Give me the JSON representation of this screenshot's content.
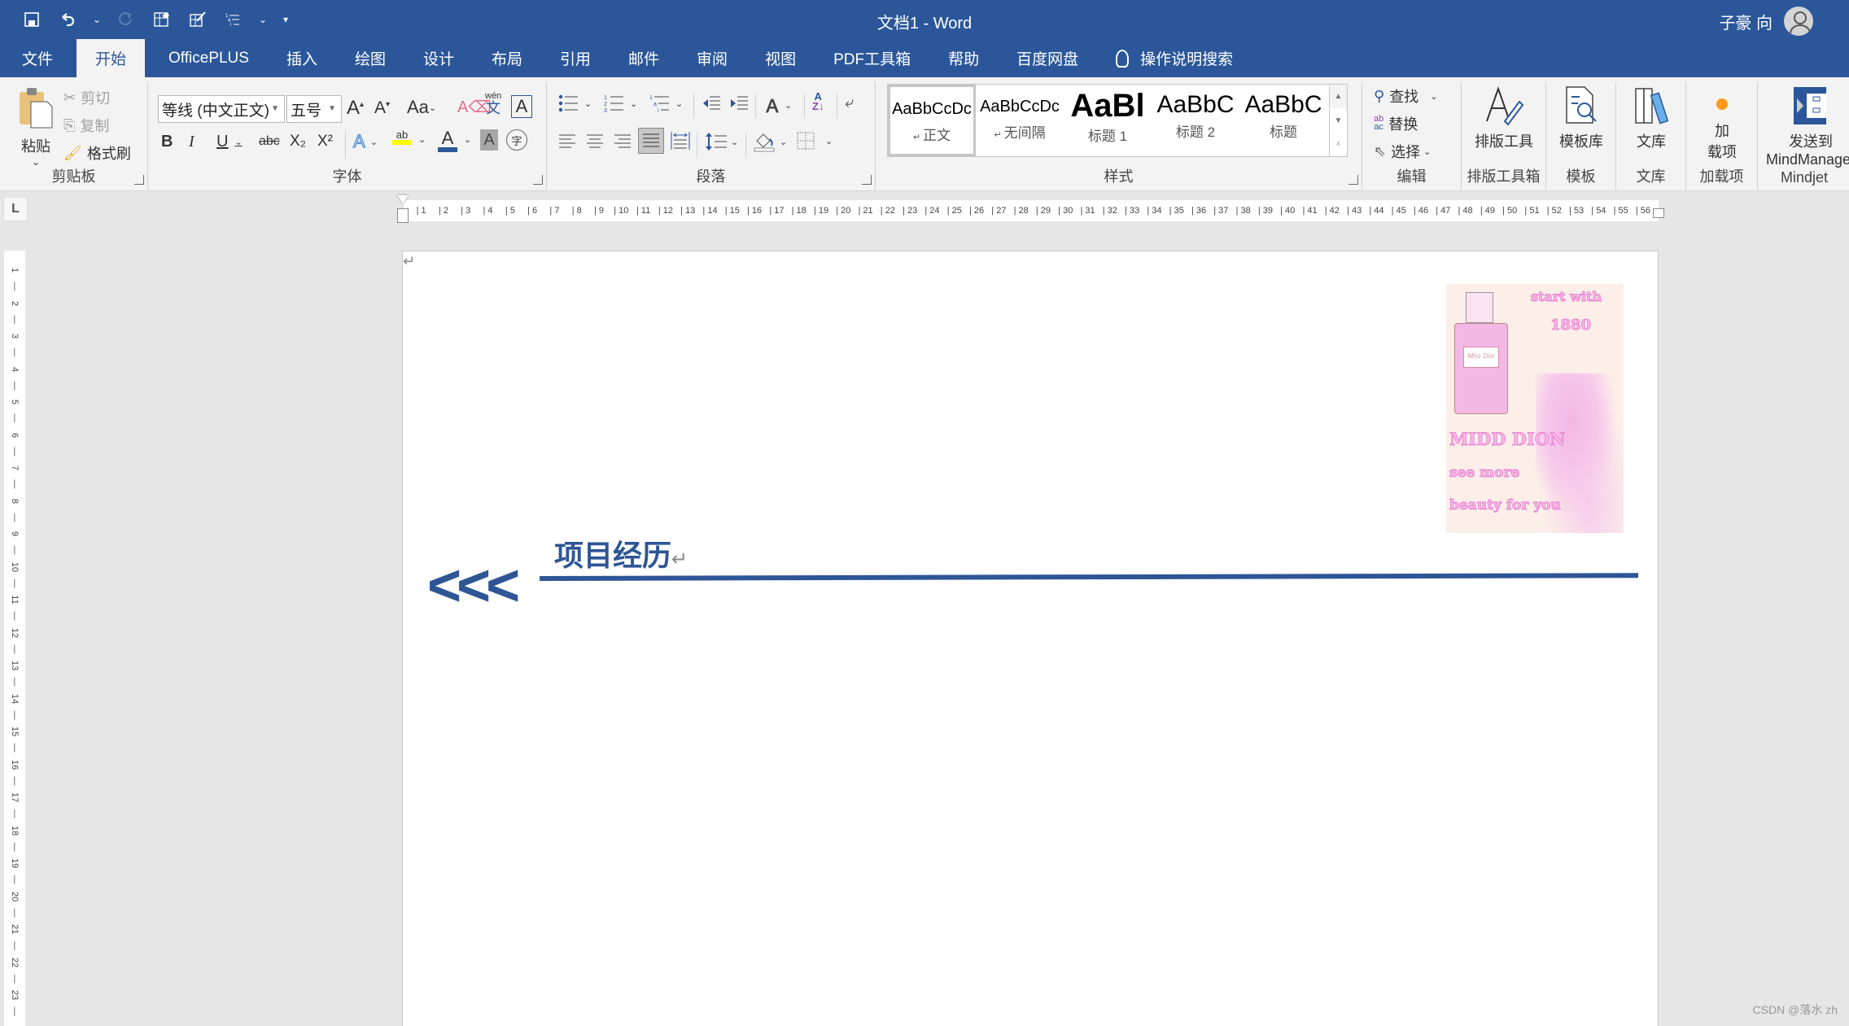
{
  "window": {
    "title": "文档1 - Word",
    "user_name": "子豪 向"
  },
  "quick_access": {
    "icons": [
      "save-icon",
      "undo-icon",
      "undo-dropdown-icon",
      "redo-icon",
      "form-icon",
      "edit-form-icon",
      "multilevel-list-icon",
      "multilevel-dropdown-icon",
      "customize-qat-icon"
    ]
  },
  "tabs": [
    {
      "label": "文件",
      "active": false
    },
    {
      "label": "开始",
      "active": true
    },
    {
      "label": "OfficePLUS",
      "active": false
    },
    {
      "label": "插入",
      "active": false
    },
    {
      "label": "绘图",
      "active": false
    },
    {
      "label": "设计",
      "active": false
    },
    {
      "label": "布局",
      "active": false
    },
    {
      "label": "引用",
      "active": false
    },
    {
      "label": "邮件",
      "active": false
    },
    {
      "label": "审阅",
      "active": false
    },
    {
      "label": "视图",
      "active": false
    },
    {
      "label": "PDF工具箱",
      "active": false
    },
    {
      "label": "帮助",
      "active": false
    },
    {
      "label": "百度网盘",
      "active": false
    }
  ],
  "tell_me": "操作说明搜索",
  "ribbon": {
    "clipboard": {
      "label": "剪贴板",
      "paste": "粘贴",
      "cut": "剪切",
      "copy": "复制",
      "format_painter": "格式刷"
    },
    "font": {
      "label": "字体",
      "font_name": "等线 (中文正文)",
      "font_size": "五号",
      "change_case": "Aa",
      "phonetic": "wén",
      "phonetic_char": "文",
      "bold": "B",
      "italic": "I",
      "underline": "U",
      "strike": "abc",
      "subscript": "X₂",
      "superscript": "X²",
      "text_effect": "A",
      "highlight": "ab",
      "font_color": "A",
      "char_shading": "A",
      "enclose": "字",
      "highlight_color": "#ffff00",
      "font_color_value": "#2b579a"
    },
    "paragraph": {
      "label": "段落"
    },
    "styles": {
      "label": "样式",
      "items": [
        {
          "sample": "AaBbCcDc",
          "name": "正文",
          "selected": true,
          "pilcrow": true
        },
        {
          "sample": "AaBbCcDc",
          "name": "无间隔",
          "selected": false,
          "pilcrow": true
        },
        {
          "sample": "AaBl",
          "name": "标题 1",
          "selected": false,
          "pilcrow": false
        },
        {
          "sample": "AaBbC",
          "name": "标题 2",
          "selected": false,
          "pilcrow": false
        },
        {
          "sample": "AaBbC",
          "name": "标题",
          "selected": false,
          "pilcrow": false
        }
      ]
    },
    "editing": {
      "label": "编辑",
      "find": "查找",
      "replace": "替换",
      "select": "选择"
    },
    "layout_tools": {
      "button": "排版工具",
      "label": "排版工具箱"
    },
    "templates": {
      "button": "模板库",
      "label": "模板"
    },
    "library": {
      "button": "文库",
      "label": "文库"
    },
    "addins": {
      "button_line1": "加",
      "button_line2": "载项",
      "label": "加载项"
    },
    "mindjet": {
      "button_line1": "发送到",
      "button_line2": "MindManager",
      "label": "Mindjet"
    }
  },
  "ruler": {
    "horizontal": [
      "1",
      "2",
      "3",
      "4",
      "5",
      "6",
      "7",
      "8",
      "9",
      "10",
      "11",
      "12",
      "13",
      "14",
      "15",
      "16",
      "17",
      "18",
      "19",
      "20",
      "21",
      "22",
      "23",
      "24",
      "25",
      "26",
      "27",
      "28",
      "29",
      "30",
      "31",
      "32",
      "33",
      "34",
      "35",
      "36",
      "37",
      "38",
      "39",
      "40",
      "41",
      "42",
      "43",
      "44",
      "45",
      "46",
      "47",
      "48",
      "49",
      "50",
      "51",
      "52",
      "53",
      "54",
      "55",
      "56"
    ],
    "vertical": [
      "1",
      "2",
      "3",
      "4",
      "5",
      "6",
      "7",
      "8",
      "9",
      "10",
      "11",
      "12",
      "13",
      "14",
      "15",
      "16",
      "17",
      "18",
      "19",
      "20",
      "21",
      "22",
      "23"
    ],
    "tab_selector": "L"
  },
  "document": {
    "pilcrow": "↵",
    "chevrons": "<<<",
    "heading": "项目经历",
    "accent_color": "#2e5596",
    "poster": {
      "line1": "start with",
      "line2": "1880",
      "line3": "MIDD DION",
      "line4": "see more",
      "line5": "beauty for you",
      "bottle_label": "Miss Dior"
    }
  },
  "watermark": "CSDN @落水 zh"
}
